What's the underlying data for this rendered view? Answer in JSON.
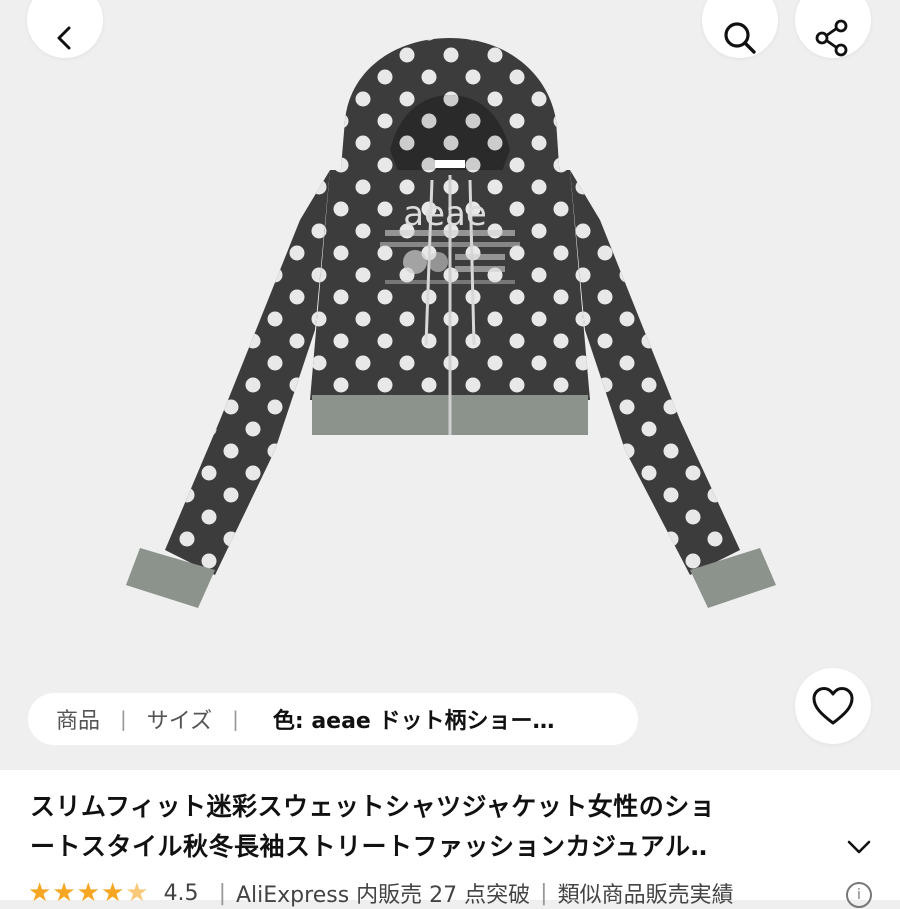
{
  "header": {
    "back_icon": "chevron-left-icon",
    "search_icon": "search-icon",
    "share_icon": "share-icon"
  },
  "product_image": {
    "print_text": "aeae"
  },
  "tabs": {
    "product": "商品",
    "size": "サイズ",
    "color": "色: aeae ドット柄ショー…"
  },
  "favorite_icon": "heart-icon",
  "info": {
    "title_line1": "スリムフィット迷彩スウェットシャツジャケット女性のショ",
    "title_line2": "ートスタイル秋冬長袖ストリートファッションカジュアル‥",
    "rating": 4.5,
    "rating_text": "4.5",
    "sales_text": "AliExpress 内販売 27 点突破",
    "similar_text": "類似商品販売実績"
  },
  "colors": {
    "star": "#f5a623",
    "jacket": "#3c3c3c",
    "rib": "#8c928c",
    "dot": "#e8e8e8"
  }
}
